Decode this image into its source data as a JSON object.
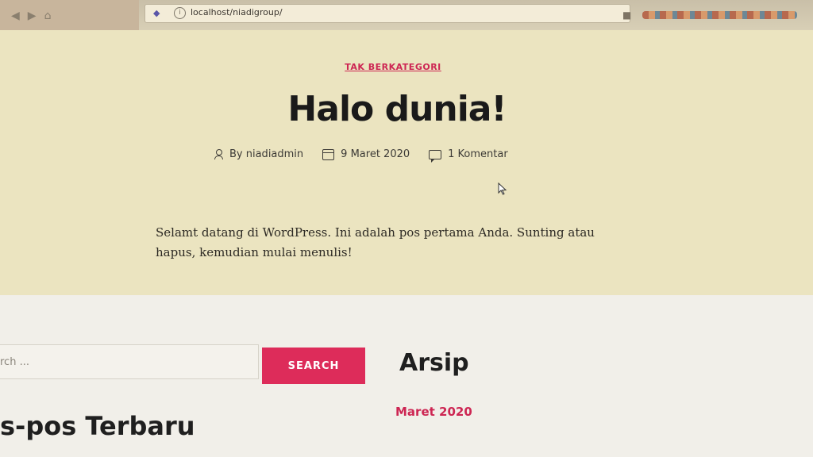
{
  "browser": {
    "url": "localhost/niadigroup/"
  },
  "post": {
    "category": "TAK BERKATEGORI",
    "title": "Halo dunia!",
    "meta": {
      "author": "By niadiadmin",
      "date": "9 Maret 2020",
      "comments": "1 Komentar"
    },
    "excerpt": "Selamt datang di WordPress. Ini adalah pos pertama Anda. Sunting atau hapus, kemudian mulai menulis!"
  },
  "widgets": {
    "search": {
      "placeholder": "rch ...",
      "button_label": "SEARCH"
    },
    "archive": {
      "title": "Arsip",
      "items": [
        "Maret 2020"
      ]
    },
    "recent_posts": {
      "title": "s-pos Terbaru"
    }
  },
  "colors": {
    "accent": "#cd2653",
    "button": "#dd2c5a",
    "background": "#ebe4c0"
  }
}
